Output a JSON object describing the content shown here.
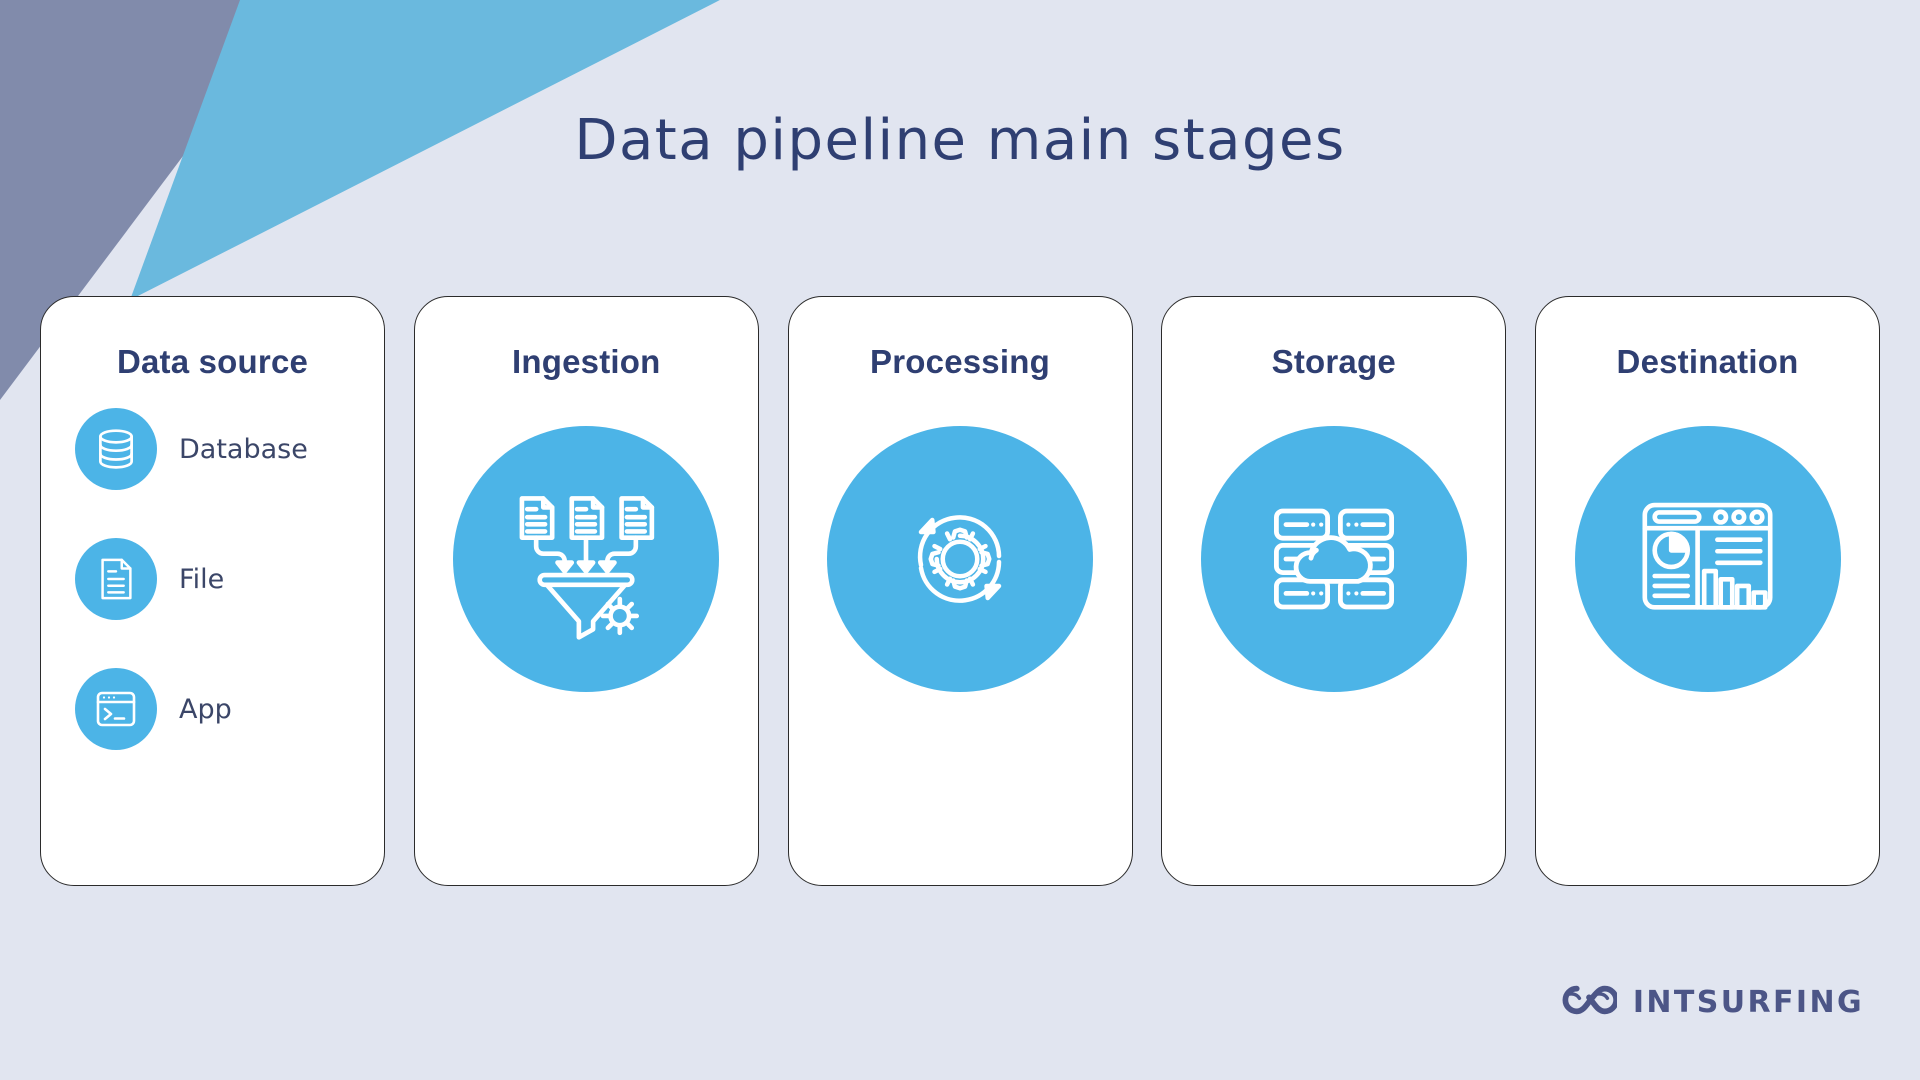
{
  "slide": {
    "title": "Data pipeline main stages",
    "background_color": "#e1e5f0",
    "accent_color": "#4cb4e7",
    "title_color": "#2f3f72",
    "deco_slate_color": "#818bab",
    "deco_blue_color": "#6ab9de"
  },
  "stages": [
    {
      "title": "Data source",
      "icon": "",
      "items": [
        {
          "label": "Database",
          "icon": "database-icon"
        },
        {
          "label": "File",
          "icon": "file-icon"
        },
        {
          "label": "App",
          "icon": "terminal-app-icon"
        }
      ]
    },
    {
      "title": "Ingestion",
      "icon": "funnel-documents-icon",
      "items": []
    },
    {
      "title": "Processing",
      "icon": "gear-refresh-icon",
      "items": []
    },
    {
      "title": "Storage",
      "icon": "server-cloud-icon",
      "items": []
    },
    {
      "title": "Destination",
      "icon": "dashboard-analytics-icon",
      "items": []
    }
  ],
  "logo": {
    "name": "INTSURFING",
    "mark": "infinity-wave-icon",
    "color": "#4c5587"
  }
}
